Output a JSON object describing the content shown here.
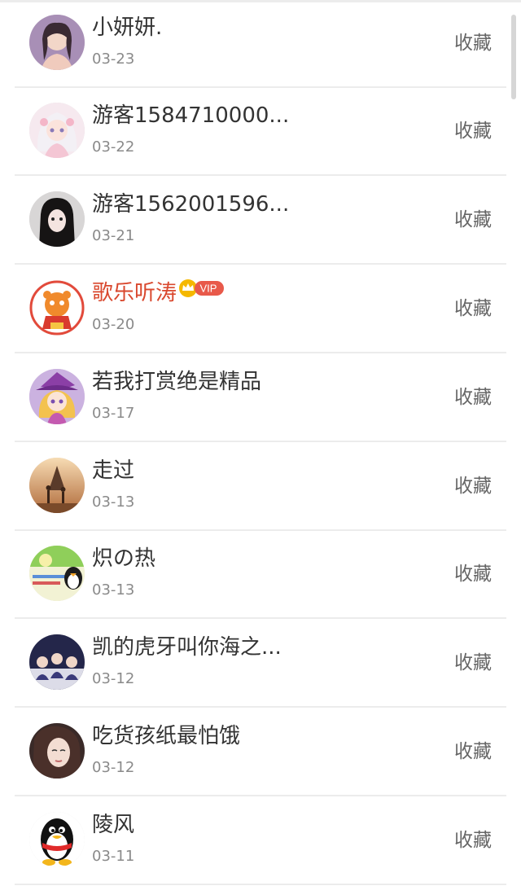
{
  "list": {
    "items": [
      {
        "name": "小妍妍.",
        "date": "03-23",
        "action": "收藏",
        "avatar": "girl-portrait"
      },
      {
        "name": "游客1584710000...",
        "date": "03-22",
        "action": "收藏",
        "avatar": "anime-girl-pastel"
      },
      {
        "name": "游客1562001596...",
        "date": "03-21",
        "action": "收藏",
        "avatar": "dark-hair-girl"
      },
      {
        "name": "歌乐听涛",
        "date": "03-20",
        "action": "收藏",
        "avatar": "tiger-mascot",
        "vip": true,
        "vip_label": "VIP"
      },
      {
        "name": "若我打赏绝是精品",
        "date": "03-17",
        "action": "收藏",
        "avatar": "anime-witch"
      },
      {
        "name": "走过",
        "date": "03-13",
        "action": "收藏",
        "avatar": "sunset-silhouette"
      },
      {
        "name": "炽の热",
        "date": "03-13",
        "action": "收藏",
        "avatar": "penguin-banner"
      },
      {
        "name": "凯的虎牙叫你海之...",
        "date": "03-12",
        "action": "收藏",
        "avatar": "group-photo"
      },
      {
        "name": "吃货孩纸最怕饿",
        "date": "03-12",
        "action": "收藏",
        "avatar": "girl-closeup"
      },
      {
        "name": "陵风",
        "date": "03-11",
        "action": "收藏",
        "avatar": "qq-penguin"
      }
    ]
  },
  "colors": {
    "vip_name": "#d9482e",
    "vip_badge": "#e8594a",
    "crown": "#f5b800",
    "divider": "#ececec"
  }
}
